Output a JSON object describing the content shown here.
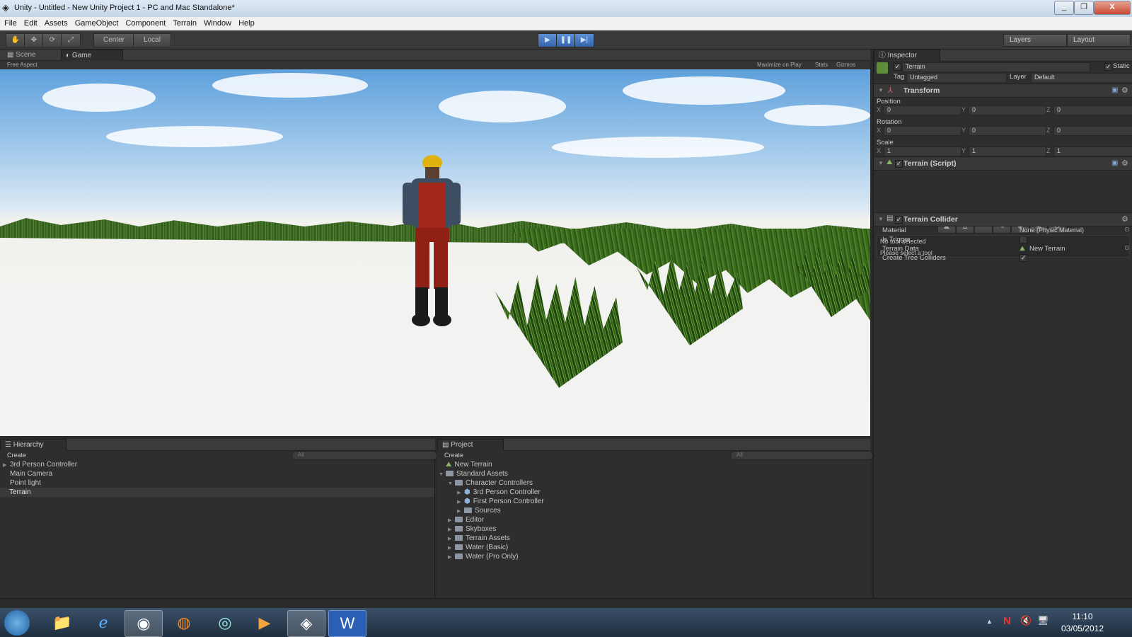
{
  "window": {
    "title": "Unity - Untitled - New Unity Project 1 - PC and Mac Standalone*",
    "buttons": [
      "_",
      "❐",
      "X"
    ]
  },
  "menu": [
    "File",
    "Edit",
    "Assets",
    "GameObject",
    "Component",
    "Terrain",
    "Window",
    "Help"
  ],
  "toolbar": {
    "center": "Center",
    "local": "Local",
    "layers": "Layers",
    "layout": "Layout"
  },
  "scene_tabs": {
    "scene": "Scene",
    "game": "Game",
    "aspect": "Free Aspect",
    "maximize": "Maximize on Play",
    "stats": "Stats",
    "gizmos": "Gizmos"
  },
  "inspector": {
    "tab": "Inspector",
    "object_name": "Terrain",
    "static_label": "Static",
    "tag_label": "Tag",
    "tag_value": "Untagged",
    "layer_label": "Layer",
    "layer_value": "Default",
    "transform": {
      "title": "Transform",
      "position": {
        "label": "Position",
        "x": "0",
        "y": "0",
        "z": "0"
      },
      "rotation": {
        "label": "Rotation",
        "x": "0",
        "y": "0",
        "z": "0"
      },
      "scale": {
        "label": "Scale",
        "x": "1",
        "y": "1",
        "z": "1"
      },
      "axis": {
        "x": "X",
        "y": "Y",
        "z": "Z"
      }
    },
    "terrain_script": {
      "title": "Terrain (Script)",
      "status1": "No tool selected",
      "status2": "Please select a tool"
    },
    "terrain_collider": {
      "title": "Terrain Collider",
      "material_label": "Material",
      "material_value": "None (Physic Material)",
      "trigger_label": "Is Trigger",
      "data_label": "Terrain Data",
      "data_value": "New Terrain",
      "trees_label": "Create Tree Colliders"
    }
  },
  "hierarchy": {
    "tab": "Hierarchy",
    "create": "Create",
    "search": "All",
    "items": [
      "3rd Person Controller",
      "Main Camera",
      "Point light",
      "Terrain"
    ]
  },
  "project": {
    "tab": "Project",
    "create": "Create",
    "search": "All",
    "items": [
      "New Terrain",
      "Standard Assets",
      "Character Controllers",
      "3rd Person Controller",
      "First Person Controller",
      "Sources",
      "Editor",
      "Skyboxes",
      "Terrain Assets",
      "Water (Basic)",
      "Water (Pro Only)"
    ]
  },
  "taskbar": {
    "time": "11:10",
    "date": "03/05/2012"
  }
}
